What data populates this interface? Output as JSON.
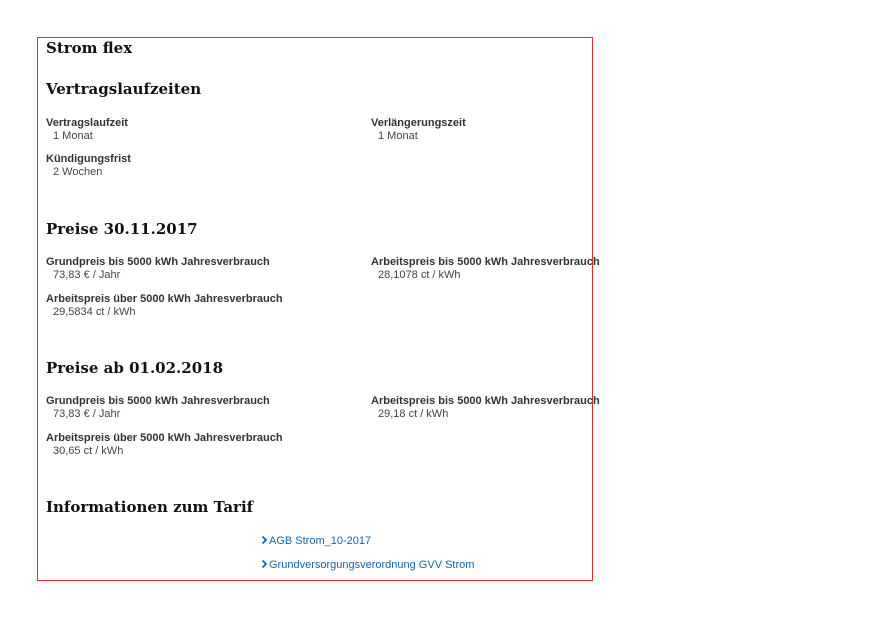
{
  "tariff": {
    "name": "Strom flex",
    "border_color": "#e0312b",
    "link_color": "#1565a8"
  },
  "contract": {
    "heading": "Vertragslaufzeiten",
    "term_label": "Vertragslaufzeit",
    "term_value": "1 Monat",
    "extension_label": "Verlängerungszeit",
    "extension_value": "1 Monat",
    "notice_label": "Kündigungsfrist",
    "notice_value": "2 Wochen"
  },
  "prices_2017": {
    "heading": "Preise 30.11.2017",
    "base_label": "Grundpreis bis 5000 kWh Jahresverbrauch",
    "base_value": "73,83 € / Jahr",
    "work_upto_label": "Arbeitspreis bis 5000 kWh Jahresverbrauch",
    "work_upto_value": "28,1078 ct / kWh",
    "work_over_label": "Arbeitspreis über 5000 kWh Jahresverbrauch",
    "work_over_value": "29,5834 ct / kWh"
  },
  "prices_2018": {
    "heading": "Preise ab 01.02.2018",
    "base_label": "Grundpreis bis 5000 kWh Jahresverbrauch",
    "base_value": "73,83 € / Jahr",
    "work_upto_label": "Arbeitspreis bis 5000 kWh Jahresverbrauch",
    "work_upto_value": "29,18 ct / kWh",
    "work_over_label": "Arbeitspreis über 5000 kWh Jahresverbrauch",
    "work_over_value": "30,65 ct / kWh"
  },
  "info": {
    "heading": "Informationen zum Tarif",
    "links": [
      {
        "label": "AGB Strom_10-2017",
        "icon": "chevron-right-icon"
      },
      {
        "label": "Grundversorgungsverordnung GVV Strom",
        "icon": "chevron-right-icon"
      }
    ]
  }
}
